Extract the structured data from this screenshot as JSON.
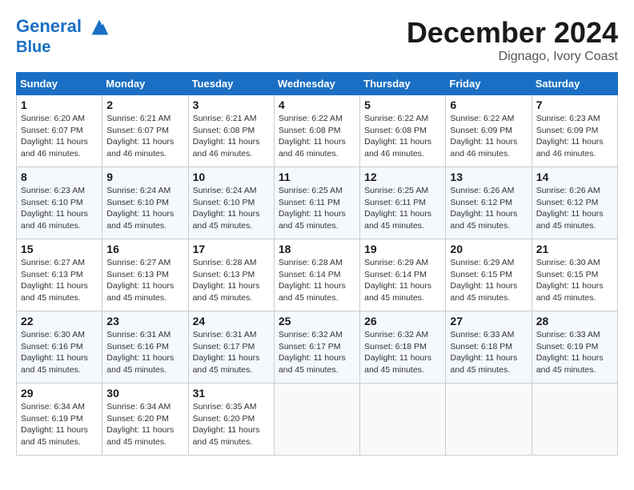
{
  "header": {
    "logo_line1": "General",
    "logo_line2": "Blue",
    "month": "December 2024",
    "location": "Dignago, Ivory Coast"
  },
  "weekdays": [
    "Sunday",
    "Monday",
    "Tuesday",
    "Wednesday",
    "Thursday",
    "Friday",
    "Saturday"
  ],
  "weeks": [
    [
      {
        "day": "1",
        "sunrise": "6:20 AM",
        "sunset": "6:07 PM",
        "daylight": "11 hours and 46 minutes."
      },
      {
        "day": "2",
        "sunrise": "6:21 AM",
        "sunset": "6:07 PM",
        "daylight": "11 hours and 46 minutes."
      },
      {
        "day": "3",
        "sunrise": "6:21 AM",
        "sunset": "6:08 PM",
        "daylight": "11 hours and 46 minutes."
      },
      {
        "day": "4",
        "sunrise": "6:22 AM",
        "sunset": "6:08 PM",
        "daylight": "11 hours and 46 minutes."
      },
      {
        "day": "5",
        "sunrise": "6:22 AM",
        "sunset": "6:08 PM",
        "daylight": "11 hours and 46 minutes."
      },
      {
        "day": "6",
        "sunrise": "6:22 AM",
        "sunset": "6:09 PM",
        "daylight": "11 hours and 46 minutes."
      },
      {
        "day": "7",
        "sunrise": "6:23 AM",
        "sunset": "6:09 PM",
        "daylight": "11 hours and 46 minutes."
      }
    ],
    [
      {
        "day": "8",
        "sunrise": "6:23 AM",
        "sunset": "6:10 PM",
        "daylight": "11 hours and 46 minutes."
      },
      {
        "day": "9",
        "sunrise": "6:24 AM",
        "sunset": "6:10 PM",
        "daylight": "11 hours and 45 minutes."
      },
      {
        "day": "10",
        "sunrise": "6:24 AM",
        "sunset": "6:10 PM",
        "daylight": "11 hours and 45 minutes."
      },
      {
        "day": "11",
        "sunrise": "6:25 AM",
        "sunset": "6:11 PM",
        "daylight": "11 hours and 45 minutes."
      },
      {
        "day": "12",
        "sunrise": "6:25 AM",
        "sunset": "6:11 PM",
        "daylight": "11 hours and 45 minutes."
      },
      {
        "day": "13",
        "sunrise": "6:26 AM",
        "sunset": "6:12 PM",
        "daylight": "11 hours and 45 minutes."
      },
      {
        "day": "14",
        "sunrise": "6:26 AM",
        "sunset": "6:12 PM",
        "daylight": "11 hours and 45 minutes."
      }
    ],
    [
      {
        "day": "15",
        "sunrise": "6:27 AM",
        "sunset": "6:13 PM",
        "daylight": "11 hours and 45 minutes."
      },
      {
        "day": "16",
        "sunrise": "6:27 AM",
        "sunset": "6:13 PM",
        "daylight": "11 hours and 45 minutes."
      },
      {
        "day": "17",
        "sunrise": "6:28 AM",
        "sunset": "6:13 PM",
        "daylight": "11 hours and 45 minutes."
      },
      {
        "day": "18",
        "sunrise": "6:28 AM",
        "sunset": "6:14 PM",
        "daylight": "11 hours and 45 minutes."
      },
      {
        "day": "19",
        "sunrise": "6:29 AM",
        "sunset": "6:14 PM",
        "daylight": "11 hours and 45 minutes."
      },
      {
        "day": "20",
        "sunrise": "6:29 AM",
        "sunset": "6:15 PM",
        "daylight": "11 hours and 45 minutes."
      },
      {
        "day": "21",
        "sunrise": "6:30 AM",
        "sunset": "6:15 PM",
        "daylight": "11 hours and 45 minutes."
      }
    ],
    [
      {
        "day": "22",
        "sunrise": "6:30 AM",
        "sunset": "6:16 PM",
        "daylight": "11 hours and 45 minutes."
      },
      {
        "day": "23",
        "sunrise": "6:31 AM",
        "sunset": "6:16 PM",
        "daylight": "11 hours and 45 minutes."
      },
      {
        "day": "24",
        "sunrise": "6:31 AM",
        "sunset": "6:17 PM",
        "daylight": "11 hours and 45 minutes."
      },
      {
        "day": "25",
        "sunrise": "6:32 AM",
        "sunset": "6:17 PM",
        "daylight": "11 hours and 45 minutes."
      },
      {
        "day": "26",
        "sunrise": "6:32 AM",
        "sunset": "6:18 PM",
        "daylight": "11 hours and 45 minutes."
      },
      {
        "day": "27",
        "sunrise": "6:33 AM",
        "sunset": "6:18 PM",
        "daylight": "11 hours and 45 minutes."
      },
      {
        "day": "28",
        "sunrise": "6:33 AM",
        "sunset": "6:19 PM",
        "daylight": "11 hours and 45 minutes."
      }
    ],
    [
      {
        "day": "29",
        "sunrise": "6:34 AM",
        "sunset": "6:19 PM",
        "daylight": "11 hours and 45 minutes."
      },
      {
        "day": "30",
        "sunrise": "6:34 AM",
        "sunset": "6:20 PM",
        "daylight": "11 hours and 45 minutes."
      },
      {
        "day": "31",
        "sunrise": "6:35 AM",
        "sunset": "6:20 PM",
        "daylight": "11 hours and 45 minutes."
      },
      null,
      null,
      null,
      null
    ]
  ]
}
